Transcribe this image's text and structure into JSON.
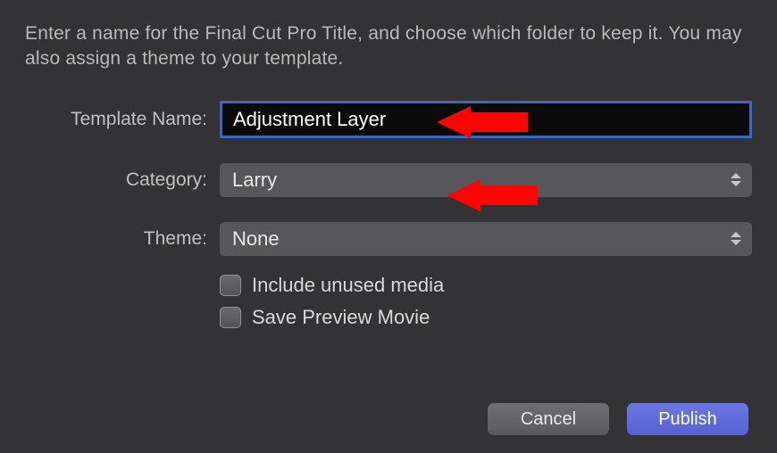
{
  "instruction": "Enter a name for the Final Cut Pro Title, and choose which folder to keep it. You may also assign a theme to your template.",
  "labels": {
    "templateName": "Template Name:",
    "category": "Category:",
    "theme": "Theme:"
  },
  "fields": {
    "templateName": "Adjustment Layer",
    "category": "Larry",
    "theme": "None"
  },
  "checkboxes": {
    "includeUnused": "Include unused media",
    "savePreview": "Save Preview Movie"
  },
  "buttons": {
    "cancel": "Cancel",
    "publish": "Publish"
  }
}
